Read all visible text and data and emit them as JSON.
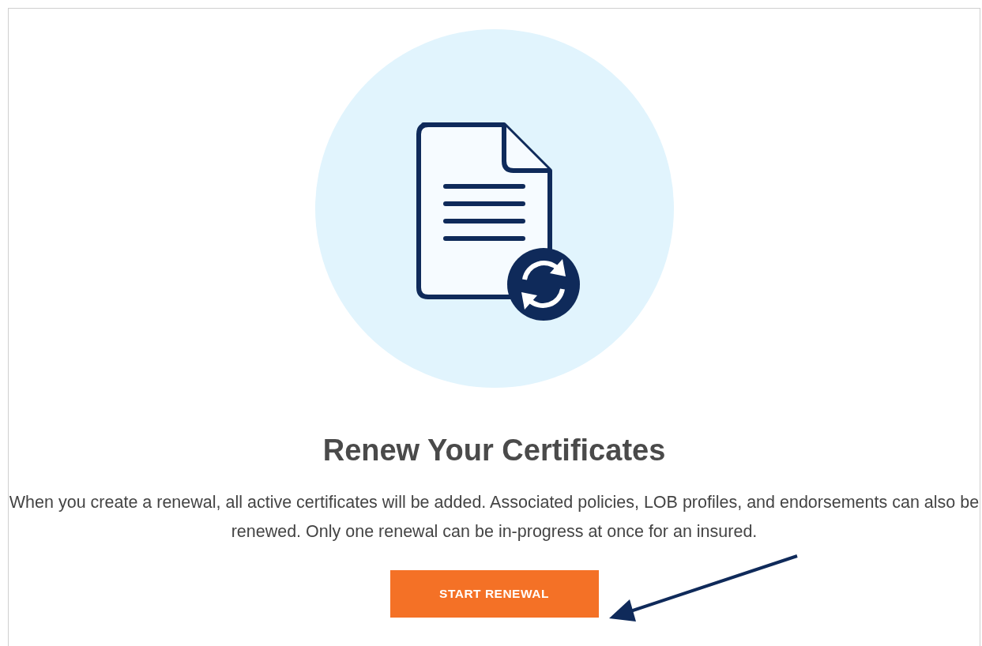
{
  "empty_state": {
    "title": "Renew Your Certificates",
    "description": "When you create a renewal, all active certificates will be added. Associated policies, LOB profiles, and endorsements can also be renewed. Only one renewal can be in-progress at once for an insured.",
    "button": {
      "label": "START RENEWAL"
    }
  }
}
